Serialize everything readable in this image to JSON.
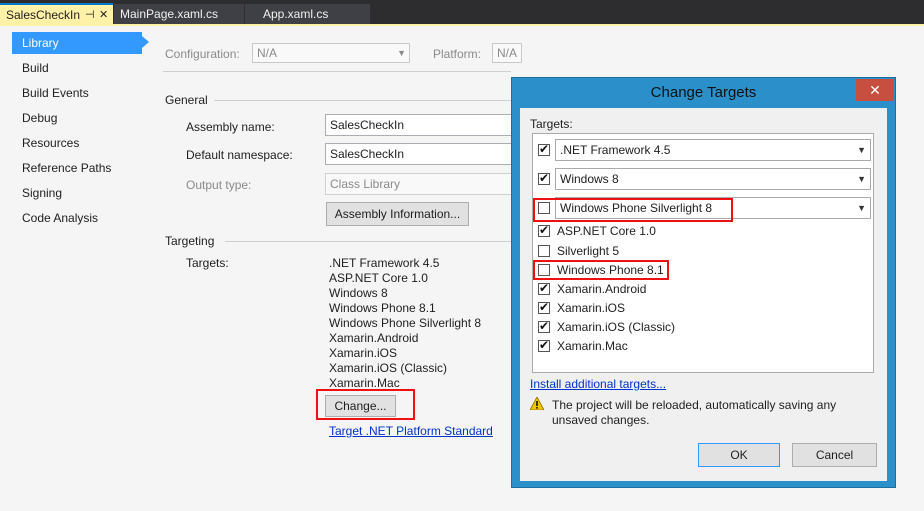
{
  "tabs": [
    {
      "label": "SalesCheckIn",
      "active": true
    },
    {
      "label": "MainPage.xaml.cs",
      "active": false
    },
    {
      "label": "App.xaml.cs",
      "active": false
    }
  ],
  "nav": {
    "items": [
      "Library",
      "Build",
      "Build Events",
      "Debug",
      "Resources",
      "Reference Paths",
      "Signing",
      "Code Analysis"
    ]
  },
  "config": {
    "configuration_label": "Configuration:",
    "configuration_value": "N/A",
    "platform_label": "Platform:",
    "platform_value": "N/A"
  },
  "general": {
    "heading": "General",
    "assembly_name_label": "Assembly name:",
    "assembly_name_value": "SalesCheckIn",
    "default_namespace_label": "Default namespace:",
    "default_namespace_value": "SalesCheckIn",
    "output_type_label": "Output type:",
    "output_type_value": "Class Library",
    "assembly_info_button": "Assembly Information..."
  },
  "targeting": {
    "heading": "Targeting",
    "targets_label": "Targets:",
    "targets": [
      ".NET Framework 4.5",
      "ASP.NET Core 1.0",
      "Windows 8",
      "Windows Phone 8.1",
      "Windows Phone Silverlight 8",
      "Xamarin.Android",
      "Xamarin.iOS",
      "Xamarin.iOS (Classic)",
      "Xamarin.Mac"
    ],
    "change_button": "Change...",
    "platform_standard_link": "Target .NET Platform Standard"
  },
  "dialog": {
    "title": "Change Targets",
    "close_glyph": "✕",
    "targets_label": "Targets:",
    "items": [
      {
        "label": ".NET Framework 4.5",
        "checked": true,
        "dropdown": true
      },
      {
        "label": "Windows 8",
        "checked": true,
        "dropdown": true
      },
      {
        "label": "Windows Phone Silverlight 8",
        "checked": false,
        "dropdown": true
      },
      {
        "label": "ASP.NET Core 1.0",
        "checked": true,
        "dropdown": false
      },
      {
        "label": "Silverlight 5",
        "checked": false,
        "dropdown": false
      },
      {
        "label": "Windows Phone 8.1",
        "checked": false,
        "dropdown": false
      },
      {
        "label": "Xamarin.Android",
        "checked": true,
        "dropdown": false
      },
      {
        "label": "Xamarin.iOS",
        "checked": true,
        "dropdown": false
      },
      {
        "label": "Xamarin.iOS (Classic)",
        "checked": true,
        "dropdown": false
      },
      {
        "label": "Xamarin.Mac",
        "checked": true,
        "dropdown": false
      }
    ],
    "install_link": "Install additional targets...",
    "warning_text_1": "The project will be reloaded, automatically saving any",
    "warning_text_2": "unsaved changes.",
    "ok_button": "OK",
    "cancel_button": "Cancel"
  },
  "colors": {
    "accent": "#3399ff",
    "highlight": "#e11111",
    "dialog_frame": "#2b90c9"
  }
}
